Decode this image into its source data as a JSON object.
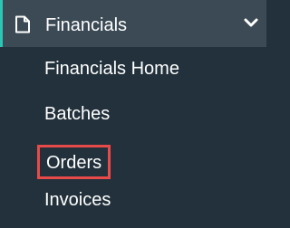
{
  "sidebar": {
    "section": {
      "label": "Financials",
      "icon": "document-icon",
      "expand_icon": "chevron-down-icon",
      "accent_color": "#2bc6b4"
    },
    "items": [
      {
        "label": "Financials Home"
      },
      {
        "label": "Batches"
      },
      {
        "label": "Orders",
        "highlighted": true,
        "highlight_color": "#e84a4a"
      },
      {
        "label": "Invoices"
      }
    ]
  },
  "colors": {
    "background": "#22313b",
    "header_background": "#3b4a54",
    "text": "#ffffff"
  }
}
